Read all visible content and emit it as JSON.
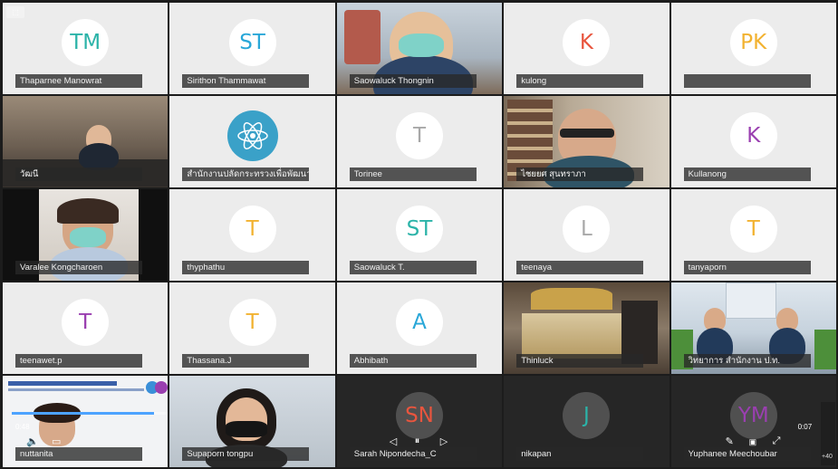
{
  "tiles": [
    {
      "name": "Thaparnee Manowrat",
      "initials": "TM",
      "color": "#2bb3a8",
      "type": "avatar"
    },
    {
      "name": "Sirithon Thammawat",
      "initials": "ST",
      "color": "#29a7d8",
      "type": "avatar"
    },
    {
      "name": "Saowaluck Thongnin",
      "type": "video"
    },
    {
      "name": "kulong",
      "initials": "K",
      "color": "#e8553e",
      "type": "avatar"
    },
    {
      "name": "",
      "initials": "PK",
      "color": "#f2b230",
      "type": "avatar"
    },
    {
      "name": "วัฒนี",
      "type": "video"
    },
    {
      "name": "สำนักงานปลัดกระทรวงเพื่อพัฒนา",
      "type": "logo"
    },
    {
      "name": "Torinee",
      "initials": "T",
      "color": "#a8a8a8",
      "type": "avatar"
    },
    {
      "name": "ไชยยศ สุนทราภา",
      "type": "video"
    },
    {
      "name": "Kullanong",
      "initials": "K",
      "color": "#9a3fb0",
      "type": "avatar"
    },
    {
      "name": "Varalee Kongcharoen",
      "type": "video"
    },
    {
      "name": "thyphathu",
      "initials": "T",
      "color": "#f2b230",
      "type": "avatar"
    },
    {
      "name": "Saowaluck T.",
      "initials": "ST",
      "color": "#2bb3a8",
      "type": "avatar"
    },
    {
      "name": "teenaya",
      "initials": "L",
      "color": "#a8a8a8",
      "type": "avatar"
    },
    {
      "name": "tanyaporn",
      "initials": "T",
      "color": "#f2b230",
      "type": "avatar"
    },
    {
      "name": "teenawet.p",
      "initials": "T",
      "color": "#9a3fb0",
      "type": "avatar"
    },
    {
      "name": "Thassana.J",
      "initials": "T",
      "color": "#f2b230",
      "type": "avatar"
    },
    {
      "name": "Abhibath",
      "initials": "A",
      "color": "#29a7d8",
      "type": "avatar"
    },
    {
      "name": "Thinluck",
      "type": "video"
    },
    {
      "name": "วิทยาการ สำนักงาน ป.ท.",
      "type": "video"
    },
    {
      "name": "nuttanita",
      "type": "video"
    },
    {
      "name": "Supaporn tongpu",
      "type": "video"
    },
    {
      "name": "Sarah Nipondecha_C",
      "initials": "SN",
      "color": "#e8553e",
      "type": "avatar-dark"
    },
    {
      "name": "nikapan",
      "initials": "J",
      "color": "#2bb3a8",
      "type": "avatar-dark"
    },
    {
      "name": "Yuphanee Meechoubar",
      "initials": "YM",
      "color": "#9a3fb0",
      "type": "avatar-dark"
    }
  ],
  "controls": {
    "corner_label": "⬚",
    "time_left": "0:48",
    "time_right": "0:07",
    "play_pause": "⏸",
    "prev": "◁",
    "next": "▷",
    "progress": 0.88
  },
  "side_panel_text": "+40"
}
